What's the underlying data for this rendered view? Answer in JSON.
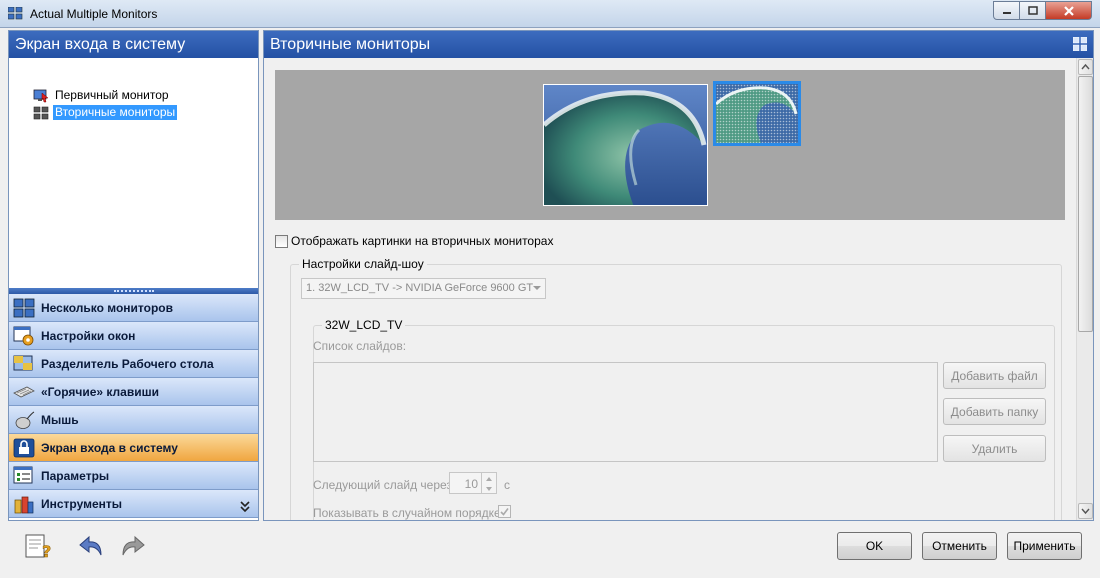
{
  "window": {
    "title": "Actual Multiple Monitors",
    "icon": "multi-monitor-icon",
    "controls": [
      "minimize-icon",
      "maximize-icon",
      "close-icon"
    ]
  },
  "left_panel": {
    "header": "Экран входа в систему",
    "tree": [
      {
        "label": "Первичный монитор",
        "icon": "primary-monitor-icon",
        "selected": false
      },
      {
        "label": "Вторичные мониторы",
        "icon": "secondary-monitors-icon",
        "selected": true
      }
    ],
    "nav": [
      {
        "label": "Несколько мониторов",
        "icon": "multi-monitor-icon",
        "active": false
      },
      {
        "label": "Настройки окон",
        "icon": "window-settings-icon",
        "active": false
      },
      {
        "label": "Разделитель Рабочего стола",
        "icon": "desktop-divider-icon",
        "active": false
      },
      {
        "label": "«Горячие» клавиши",
        "icon": "keyboard-icon",
        "active": false
      },
      {
        "label": "Мышь",
        "icon": "mouse-icon",
        "active": false
      },
      {
        "label": "Экран входа в систему",
        "icon": "lock-icon",
        "active": true
      },
      {
        "label": "Параметры",
        "icon": "options-icon",
        "active": false
      },
      {
        "label": "Инструменты",
        "icon": "tools-icon",
        "active": false
      }
    ],
    "more": "»"
  },
  "right_panel": {
    "header": "Вторичные мониторы",
    "show_pictures_label": "Отображать картинки на вторичных мониторах",
    "show_pictures_checked": false,
    "slideshow_group": "Настройки слайд-шоу",
    "monitor_select": "1. 32W_LCD_TV -> NVIDIA GeForce 9600 GT",
    "monitor_group": "32W_LCD_TV",
    "slides_list_label": "Список слайдов:",
    "add_file": "Добавить файл",
    "add_folder": "Добавить папку",
    "delete": "Удалить",
    "next_slide_label": "Следующий слайд через:",
    "next_slide_value": "10",
    "seconds": "с",
    "random_order_label": "Показывать в случайном порядке",
    "random_order_checked": true
  },
  "footer": {
    "icons": [
      "help-icon",
      "undo-icon",
      "redo-icon"
    ],
    "ok": "OK",
    "cancel": "Отменить",
    "apply": "Применить"
  }
}
